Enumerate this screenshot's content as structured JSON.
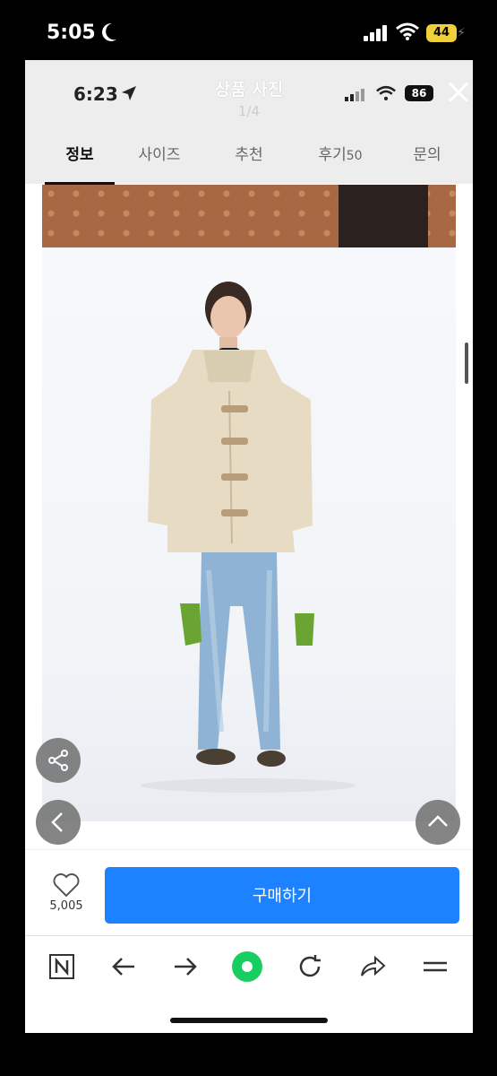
{
  "outer_status": {
    "time": "5:05",
    "battery": "44"
  },
  "inner_status": {
    "time": "6:23",
    "battery": "86"
  },
  "header": {
    "title": "상품 사진",
    "counter": "1/4"
  },
  "tabs": [
    {
      "label": "정보"
    },
    {
      "label": "사이즈"
    },
    {
      "label": "추천"
    },
    {
      "label": "후기",
      "count": "50"
    },
    {
      "label": "문의"
    }
  ],
  "product": {
    "like_count": "5,005",
    "buy_label": "구매하기"
  },
  "colors": {
    "accent": "#1d82ff",
    "jacket": "#e7dcc3",
    "jeans": "#8fb3d4",
    "gloves": "#6aa534"
  },
  "icons": [
    "moon-icon",
    "signal-icon",
    "wifi-icon",
    "location-arrow-icon",
    "close-icon",
    "share-icon",
    "chevron-left-icon",
    "chevron-up-icon",
    "heart-icon",
    "naver-n-icon",
    "arrow-left-icon",
    "arrow-right-icon",
    "green-dot-icon",
    "refresh-icon",
    "share-arrow-icon",
    "menu-icon"
  ]
}
